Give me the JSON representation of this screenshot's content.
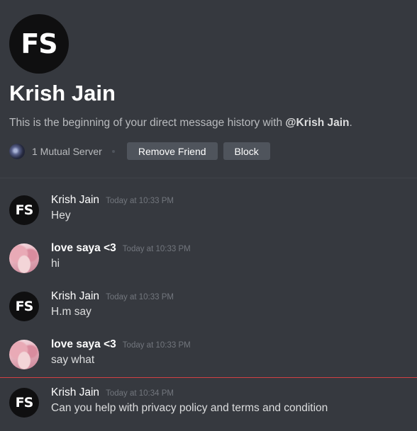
{
  "header": {
    "avatar_logo": "FS",
    "title": "Krish Jain",
    "intro_prefix": "This is the beginning of your direct message history with ",
    "intro_mention": "@Krish Jain",
    "intro_suffix": ".",
    "mutual_servers": "1 Mutual Server",
    "remove_friend_label": "Remove Friend",
    "block_label": "Block"
  },
  "messages": [
    {
      "author": "Krish Jain",
      "time": "Today at 10:33 PM",
      "text": "Hey",
      "avatar": "FS"
    },
    {
      "author": "love saya <3",
      "time": "Today at 10:33 PM",
      "text": "hi",
      "avatar": "anime"
    },
    {
      "author": "Krish Jain",
      "time": "Today at 10:33 PM",
      "text": "H.m say",
      "avatar": "FS"
    },
    {
      "author": "love saya <3",
      "time": "Today at 10:33 PM",
      "text": "say what",
      "avatar": "anime"
    },
    {
      "author": "Krish Jain",
      "time": "Today at 10:34 PM",
      "text": "Can you help with privacy policy and terms and condition",
      "avatar": "FS"
    }
  ],
  "colors": {
    "background": "#36393f",
    "button": "#4f545c",
    "new_messages_line": "#ed4245"
  }
}
